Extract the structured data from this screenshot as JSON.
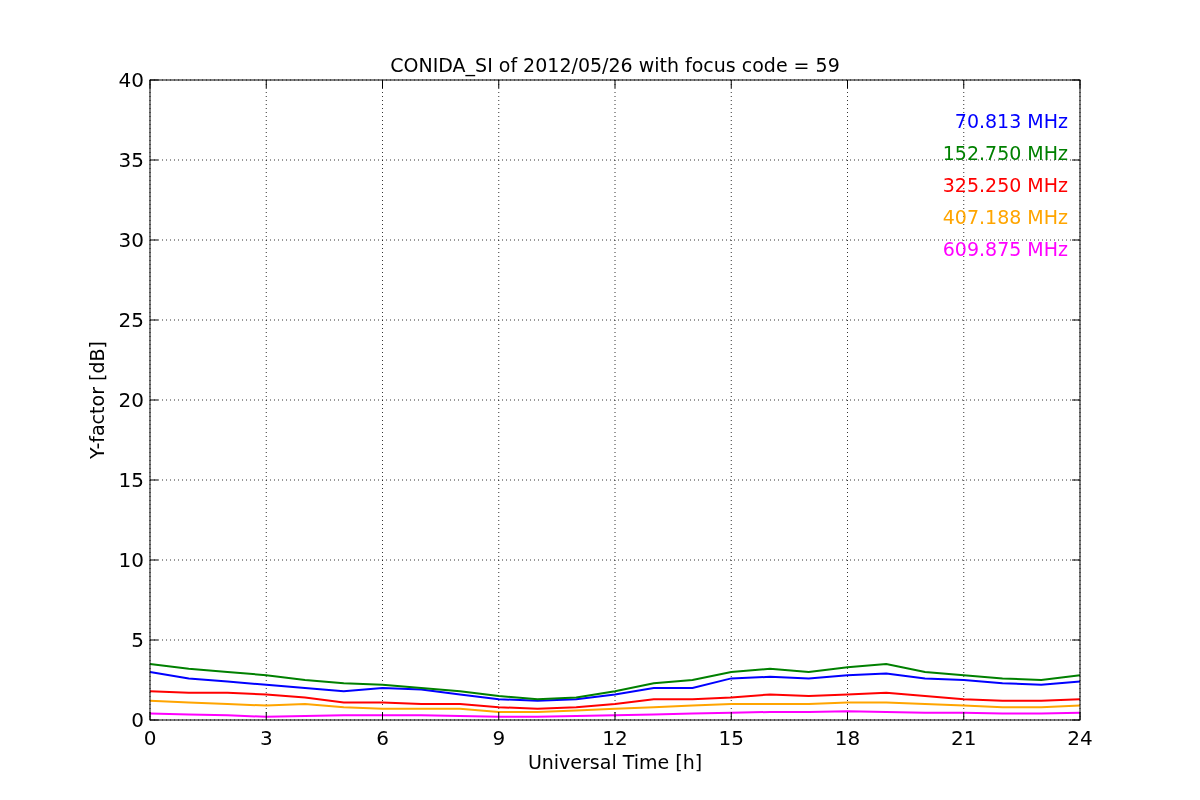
{
  "figure": {
    "chart_data": {
      "type": "line",
      "title": "CONIDA_SI of 2012/05/26 with focus code = 59",
      "xlabel": "Universal Time [h]",
      "ylabel": "Y-factor [dB]",
      "x": [
        0,
        1,
        2,
        3,
        4,
        5,
        6,
        7,
        8,
        9,
        10,
        11,
        12,
        13,
        14,
        15,
        16,
        17,
        18,
        19,
        20,
        21,
        22,
        23,
        24
      ],
      "grid": true,
      "xlim": [
        0,
        24
      ],
      "ylim": [
        0,
        40
      ],
      "xticks": [
        0,
        3,
        6,
        9,
        12,
        15,
        18,
        21,
        24
      ],
      "yticks": [
        0,
        5,
        10,
        15,
        20,
        25,
        30,
        35,
        40
      ],
      "series": [
        {
          "name": "70.813 MHz",
          "color": "#0000ff",
          "values": [
            3.0,
            2.6,
            2.4,
            2.2,
            2.0,
            1.8,
            2.0,
            1.9,
            1.6,
            1.3,
            1.2,
            1.3,
            1.6,
            2.0,
            2.0,
            2.6,
            2.7,
            2.6,
            2.8,
            2.9,
            2.6,
            2.5,
            2.3,
            2.2,
            2.4
          ]
        },
        {
          "name": "152.750 MHz",
          "color": "#008000",
          "values": [
            3.5,
            3.2,
            3.0,
            2.8,
            2.5,
            2.3,
            2.2,
            2.0,
            1.8,
            1.5,
            1.3,
            1.4,
            1.8,
            2.3,
            2.5,
            3.0,
            3.2,
            3.0,
            3.3,
            3.5,
            3.0,
            2.8,
            2.6,
            2.5,
            2.8
          ]
        },
        {
          "name": "325.250 MHz",
          "color": "#ff0000",
          "values": [
            1.8,
            1.7,
            1.7,
            1.6,
            1.4,
            1.1,
            1.1,
            1.0,
            1.0,
            0.8,
            0.7,
            0.8,
            1.0,
            1.3,
            1.3,
            1.4,
            1.6,
            1.5,
            1.6,
            1.7,
            1.5,
            1.3,
            1.2,
            1.2,
            1.3
          ]
        },
        {
          "name": "407.188 MHz",
          "color": "#ffa500",
          "values": [
            1.2,
            1.1,
            1.0,
            0.9,
            1.0,
            0.8,
            0.7,
            0.7,
            0.7,
            0.5,
            0.5,
            0.6,
            0.7,
            0.8,
            0.9,
            1.0,
            1.0,
            1.0,
            1.1,
            1.1,
            1.0,
            0.9,
            0.8,
            0.8,
            0.9
          ]
        },
        {
          "name": "609.875 MHz",
          "color": "#ff00ff",
          "values": [
            0.4,
            0.35,
            0.3,
            0.2,
            0.25,
            0.3,
            0.3,
            0.3,
            0.25,
            0.2,
            0.2,
            0.25,
            0.3,
            0.35,
            0.4,
            0.45,
            0.5,
            0.5,
            0.55,
            0.5,
            0.45,
            0.45,
            0.4,
            0.4,
            0.45
          ]
        }
      ]
    }
  }
}
